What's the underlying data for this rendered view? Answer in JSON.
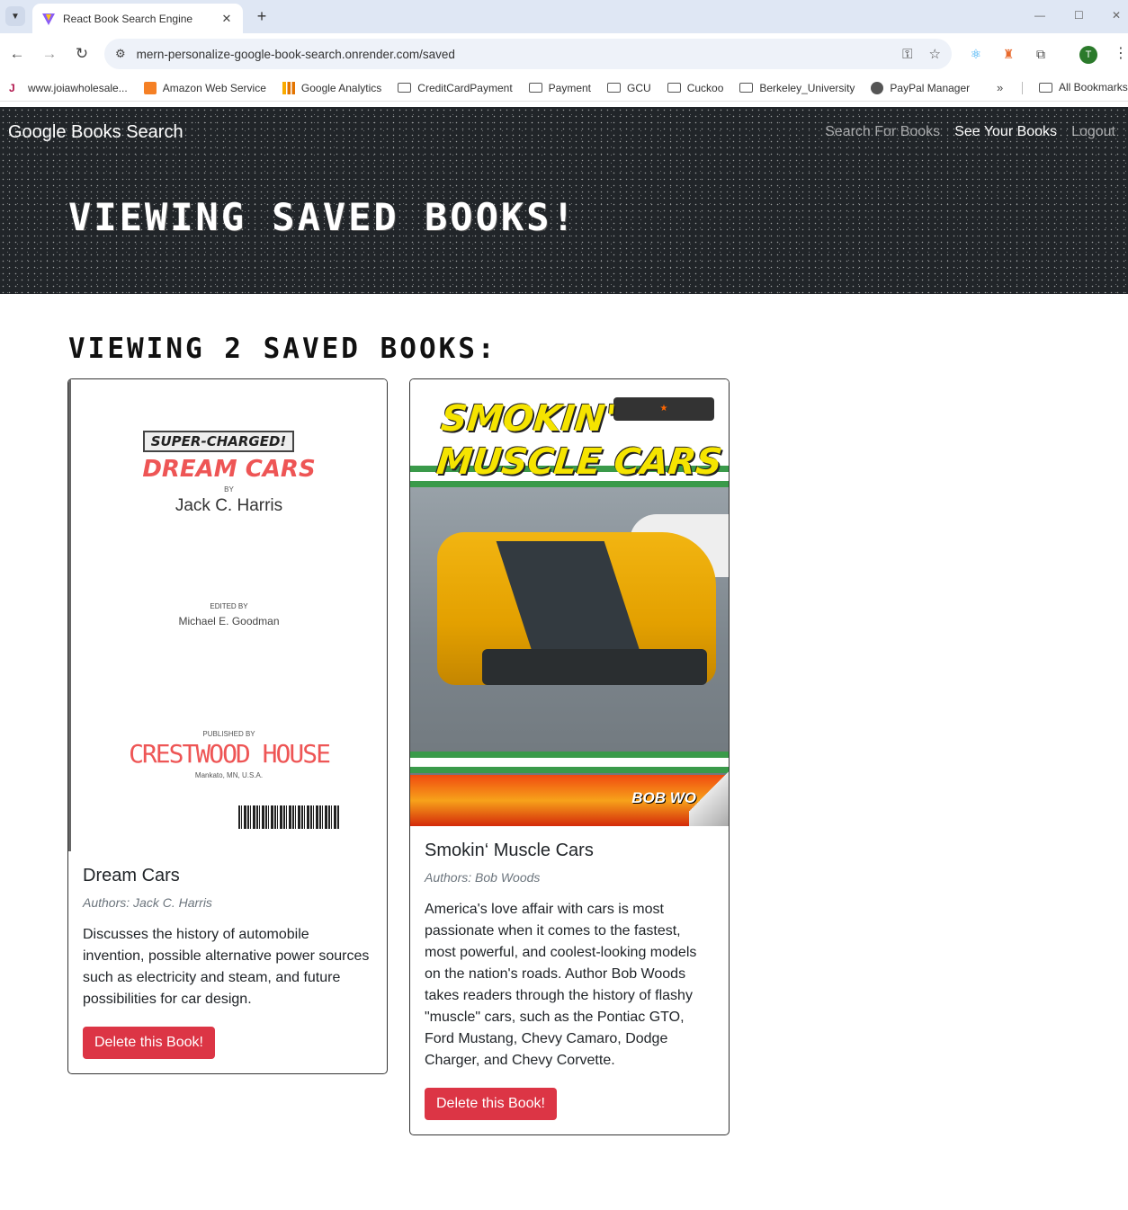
{
  "browser": {
    "tab_title": "React Book Search Engine",
    "tab_close": "✕",
    "new_tab": "+",
    "url": "mern-personalize-google-book-search.onrender.com/saved",
    "avatar_letter": "T",
    "bookmarks": [
      {
        "label": "www.joiawholesale...",
        "icon": "j-icon"
      },
      {
        "label": "Amazon Web Service",
        "icon": "aws-icon"
      },
      {
        "label": "Google Analytics",
        "icon": "analytics-icon"
      },
      {
        "label": "CreditCardPayment",
        "icon": "folder-icon"
      },
      {
        "label": "Payment",
        "icon": "folder-icon"
      },
      {
        "label": "GCU",
        "icon": "folder-icon"
      },
      {
        "label": "Cuckoo",
        "icon": "folder-icon"
      },
      {
        "label": "Berkeley_University",
        "icon": "folder-icon"
      },
      {
        "label": "PayPal Manager",
        "icon": "globe-icon"
      }
    ],
    "bookmarks_overflow": "»",
    "all_bookmarks": "All Bookmarks"
  },
  "navbar": {
    "brand": "Google Books Search",
    "links": [
      {
        "label": "Search For Books",
        "active": false
      },
      {
        "label": "See Your Books",
        "active": true
      },
      {
        "label": "Logout",
        "active": false
      }
    ]
  },
  "hero": {
    "title": "Viewing saved books!"
  },
  "saved": {
    "heading": "Viewing 2 saved books:",
    "books": [
      {
        "title": "Dream Cars",
        "authors": "Authors: Jack C. Harris",
        "description": "Discusses the history of automobile invention, possible alternative power sources such as electricity and steam, and future possibilities for car design.",
        "button": "Delete this Book!",
        "cover": {
          "badge": "SUPER-CHARGED!",
          "title": "DREAM CARS",
          "by": "BY",
          "author": "Jack C. Harris",
          "edited_by": "EDITED BY",
          "editor": "Michael E. Goodman",
          "published_by": "PUBLISHED BY",
          "publisher": "CRESTWOOD HOUSE",
          "location": "Mankato, MN, U.S.A."
        }
      },
      {
        "title": "Smokin‘ Muscle Cars",
        "authors": "Authors: Bob Woods",
        "description": "America's love affair with cars is most passionate when it comes to the fastest, most powerful, and coolest-looking models on the nation's roads. Author Bob Woods takes readers through the history of flashy \"muscle\" cars, such as the Pontiac GTO, Ford Mustang, Chevy Camaro, Dodge Charger, and Chevy Corvette.",
        "button": "Delete this Book!",
        "cover": {
          "title_line1": "SMOKIN'",
          "title_line2": "MUSCLE CARS",
          "author": "BOB WO"
        }
      }
    ]
  },
  "colors": {
    "hero_bg": "#212529",
    "danger": "#dc3545"
  }
}
